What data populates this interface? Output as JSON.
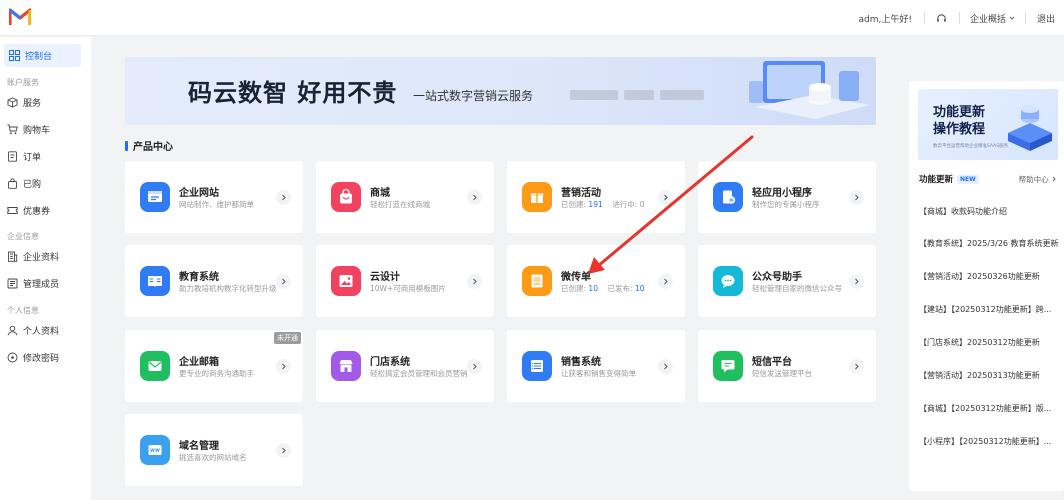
{
  "header": {
    "greeting": "adm,上午好!",
    "overview_menu": "企业概括",
    "logout": "退出"
  },
  "sidebar": {
    "active_item": "控制台",
    "groups": [
      {
        "label": "账户服务",
        "items": [
          {
            "label": "服务",
            "icon": "box-icon"
          },
          {
            "label": "购物车",
            "icon": "cart-icon"
          },
          {
            "label": "订单",
            "icon": "order-icon"
          },
          {
            "label": "已购",
            "icon": "bag-icon"
          },
          {
            "label": "优惠券",
            "icon": "coupon-icon"
          }
        ]
      },
      {
        "label": "企业信息",
        "items": [
          {
            "label": "企业资料",
            "icon": "building-icon"
          },
          {
            "label": "管理成员",
            "icon": "members-icon"
          }
        ]
      },
      {
        "label": "个人信息",
        "items": [
          {
            "label": "个人资料",
            "icon": "user-icon"
          },
          {
            "label": "修改密码",
            "icon": "lock-icon"
          }
        ]
      }
    ]
  },
  "banner": {
    "title": "码云数智  好用不贵",
    "subtitle": "一站式数字营销云服务"
  },
  "product_center": {
    "title": "产品中心",
    "cards": [
      {
        "title": "企业网站",
        "desc": "网站制作、维护都简单",
        "color": "#2f7cf6",
        "icon": "website-icon"
      },
      {
        "title": "商城",
        "desc": "轻松打造在线商城",
        "color": "#f2425f",
        "icon": "shop-bag-icon"
      },
      {
        "title": "营销活动",
        "desc_a": "已创建:",
        "num_a": "191",
        "desc_b": "进行中:",
        "num_b": "0",
        "color": "#ff9a16",
        "icon": "gift-icon"
      },
      {
        "title": "轻应用小程序",
        "desc": "制作您的专属小程序",
        "color": "#2f7cf6",
        "icon": "miniapp-icon"
      },
      {
        "title": "教育系统",
        "desc": "助力教培机构数字化转型升级",
        "color": "#2f7cf6",
        "icon": "book-icon"
      },
      {
        "title": "云设计",
        "desc": "10W+可商用模板图片",
        "color": "#f2425f",
        "icon": "image-icon"
      },
      {
        "title": "微传单",
        "desc_a": "已创建:",
        "num_a": "10",
        "desc_b": "已发布:",
        "num_b": "10",
        "color": "#ff9a16",
        "icon": "flyer-icon"
      },
      {
        "title": "公众号助手",
        "desc": "轻松管理自家的微信公众号",
        "color": "#16b8d8",
        "icon": "chat-icon"
      },
      {
        "title": "企业邮箱",
        "desc": "更专业的商务沟通助手",
        "color": "#1fbf5f",
        "icon": "mail-icon",
        "badge": "未开通"
      },
      {
        "title": "门店系统",
        "desc": "轻松搞定会员管理和会员营销",
        "color": "#a35ae8",
        "icon": "store-icon"
      },
      {
        "title": "销售系统",
        "desc": "让获客和销售变得简单",
        "color": "#2f7cf6",
        "icon": "list-icon"
      },
      {
        "title": "短信平台",
        "desc": "短信发送管理平台",
        "color": "#1fbf5f",
        "icon": "sms-icon"
      },
      {
        "title": "域名管理",
        "desc": "挑选喜欢的网站域名",
        "color": "#3aa0f0",
        "icon": "www-icon"
      }
    ]
  },
  "right_panel": {
    "banner_line1": "功能更新",
    "banner_line2": "操作教程",
    "banner_small": "数云平台运营帮助企业精准SAAS服务",
    "updates_title": "功能更新",
    "new_badge": "NEW",
    "help_link": "帮助中心",
    "updates": [
      "【商城】收款码功能介绍",
      "【教育系统】2025/3/26 教育系统更新",
      "【营销活动】20250326功能更新",
      "【建站】【20250312功能更新】跨...",
      "【门店系统】20250312功能更新",
      "【营销活动】20250313功能更新",
      "【商城】【20250312功能更新】版...",
      "【小程序】【20250312功能更新】..."
    ]
  }
}
